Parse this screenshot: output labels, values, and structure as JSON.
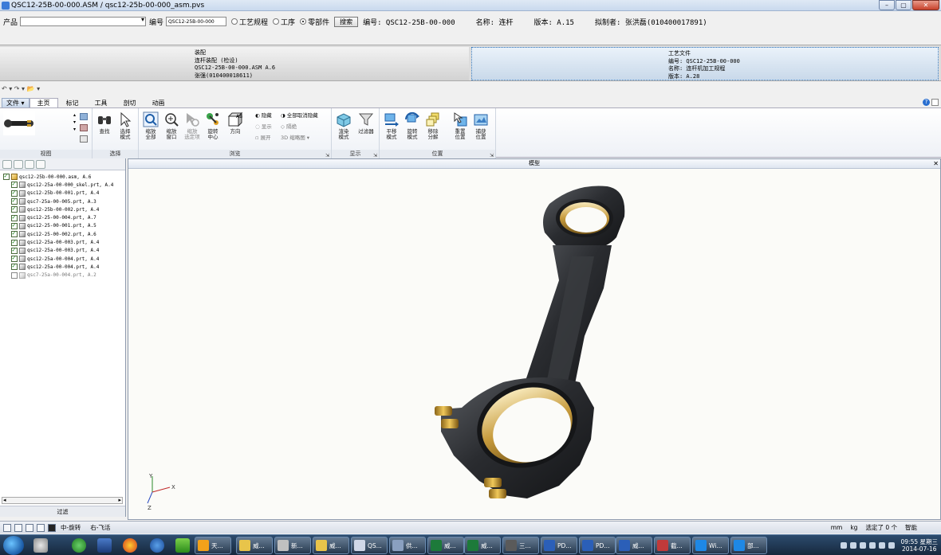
{
  "window": {
    "title": "QSC12-25B-00-000.ASM / qsc12-25b-00-000_asm.pvs",
    "min_label": "–",
    "max_label": "▢",
    "close_label": "✕"
  },
  "searchbar": {
    "product_label": "产品",
    "code_label": "编号",
    "code_value": "QSC12-25B-00-000",
    "radio_process": "工艺规程",
    "radio_step": "工序",
    "radio_part": "零部件",
    "search_button": "搜索",
    "number_info": "编号: QSC12-25B-00-000",
    "name_info": "名称: 连杆",
    "version_info": "版本: A.15",
    "author_info": "拟制者: 张洪磊(010400017891)"
  },
  "docs": {
    "left": {
      "line1": "装配",
      "line2": "连杆装配 (检设)",
      "line3": "QSC12-25B-00-000.ASM A.6",
      "line4": "张强(010400018611)"
    },
    "right": {
      "line1": "工艺文件",
      "line2": "编号: QSC12-25B-00-000",
      "line3": "名称: 连杆机加工规程",
      "line4": "版本: A.28"
    }
  },
  "qat": "↶ ▾ ↷ ▾ 📂 ▾",
  "tabs": [
    "文件 ▾",
    "主页",
    "标记",
    "工具",
    "剖切",
    "动画"
  ],
  "ribbon": {
    "groups": {
      "view": "视图",
      "select": "选择",
      "browse": "浏览",
      "display": "显示",
      "position": "位置"
    },
    "buttons": {
      "find": "查找",
      "select_mode": "选择\n模式",
      "zoom_all": "缩放\n全部",
      "zoom_window": "缩放\n窗口",
      "zoom_selected": "缩放\n选定项",
      "rotate_center": "旋转\n中心",
      "direction": "方向",
      "render_mode": "渲染\n模式",
      "filter": "过滤器",
      "pan_mode": "平移\n模式",
      "rotate_mode": "旋转\n模式",
      "explode": "移除\n分解",
      "reset_pos": "重置\n位置",
      "capture_pos": "捕获\n位置"
    },
    "small": {
      "hide": "隐藏",
      "unhide_all": "全部取消隐藏",
      "show": "显示",
      "isolate": "隔绝",
      "expand": "展开",
      "thumbnail": "3D 缩略图"
    }
  },
  "tree": {
    "items": [
      {
        "label": "qsc12-25b-00-000.asm, A.6",
        "checked": true,
        "type": "asm",
        "indent": 0
      },
      {
        "label": "qsc12-25a-00-000_skel.prt, A.4",
        "checked": true,
        "type": "prt",
        "indent": 1
      },
      {
        "label": "qsc12-25b-00-001.prt, A.4",
        "checked": true,
        "type": "prt",
        "indent": 1
      },
      {
        "label": "qsc7-25a-00-005.prt, A.3",
        "checked": true,
        "type": "prt",
        "indent": 1
      },
      {
        "label": "qsc12-25b-00-002.prt, A.4",
        "checked": true,
        "type": "prt",
        "indent": 1
      },
      {
        "label": "qsc12-25-00-004.prt, A.7",
        "checked": true,
        "type": "prt",
        "indent": 1
      },
      {
        "label": "qsc12-25-00-001.prt, A.5",
        "checked": true,
        "type": "prt",
        "indent": 1
      },
      {
        "label": "qsc12-25-00-002.prt, A.6",
        "checked": true,
        "type": "prt",
        "indent": 1
      },
      {
        "label": "qsc12-25a-00-003.prt, A.4",
        "checked": true,
        "type": "prt",
        "indent": 1
      },
      {
        "label": "qsc12-25a-00-003.prt, A.4",
        "checked": true,
        "type": "prt",
        "indent": 1
      },
      {
        "label": "qsc12-25a-00-004.prt, A.4",
        "checked": true,
        "type": "prt",
        "indent": 1
      },
      {
        "label": "qsc12-25a-00-004.prt, A.4",
        "checked": true,
        "type": "prt",
        "indent": 1
      },
      {
        "label": "qsc7-25a-00-004.prt, A.2",
        "checked": false,
        "type": "prt",
        "indent": 1
      }
    ],
    "filter_label": "过滤"
  },
  "viewport": {
    "title": "模型",
    "close": "✕",
    "axis_x": "X",
    "axis_y": "Y",
    "axis_z": "Z"
  },
  "statusbar": {
    "mode_text": "中-旋转",
    "right_text": "右-飞活",
    "unit_mm": "mm",
    "unit_kg": "kg",
    "selected": "选定了 0 个",
    "smart": "智能"
  },
  "taskbar": {
    "items": [
      {
        "label": "天...",
        "color": "#f2a11a"
      },
      {
        "label": "威...",
        "color": "#e8c44a"
      },
      {
        "label": "新...",
        "color": "#c0c0c0"
      },
      {
        "label": "威...",
        "color": "#e8c44a"
      },
      {
        "label": "QS...",
        "color": "#d0d8e8"
      },
      {
        "label": "供...",
        "color": "#8aa0c0"
      },
      {
        "label": "威...",
        "color": "#1d7a3a"
      },
      {
        "label": "威...",
        "color": "#1d7a3a"
      },
      {
        "label": "三...",
        "color": "#5a5a5a"
      },
      {
        "label": "PD...",
        "color": "#2b5fb8"
      },
      {
        "label": "PD...",
        "color": "#2b5fb8"
      },
      {
        "label": "威...",
        "color": "#2b5fb8"
      },
      {
        "label": "截...",
        "color": "#c03a3a"
      },
      {
        "label": "Wi...",
        "color": "#1e88e5"
      },
      {
        "label": "部...",
        "color": "#1e88e5"
      }
    ],
    "time": "09:55 星期三",
    "date": "2014-07-16"
  }
}
